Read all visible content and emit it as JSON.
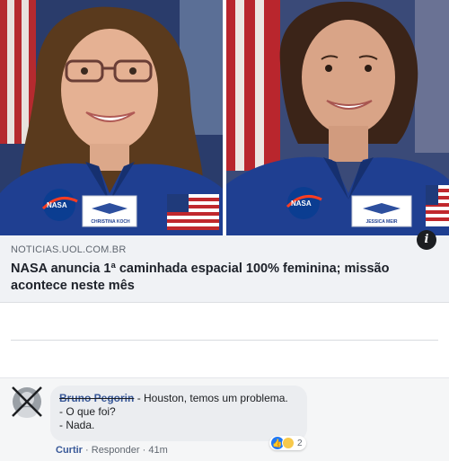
{
  "article": {
    "domain": "NOTICIAS.UOL.COM.BR",
    "headline": "NASA anuncia 1ª caminhada espacial 100% feminina; missão acontece neste mês",
    "info_icon_label": "i"
  },
  "photos": [
    {
      "badge_text": "NASA",
      "name_tag": "CHRISTINA KOCH"
    },
    {
      "badge_text": "NASA",
      "name_tag": "JESSICA MEIR"
    }
  ],
  "comment": {
    "author": "Bruno Pegorin",
    "lines": [
      "- Houston, temos um problema.",
      "- O que foi?",
      "- Nada."
    ],
    "reaction_count": "2",
    "like_action": "Curtir",
    "reply_action": "Responder",
    "separator": "·",
    "timestamp": "41m"
  },
  "colors": {
    "link_blue": "#385898",
    "suit_blue": "#1f3f91",
    "card_bg": "#f0f2f5"
  }
}
